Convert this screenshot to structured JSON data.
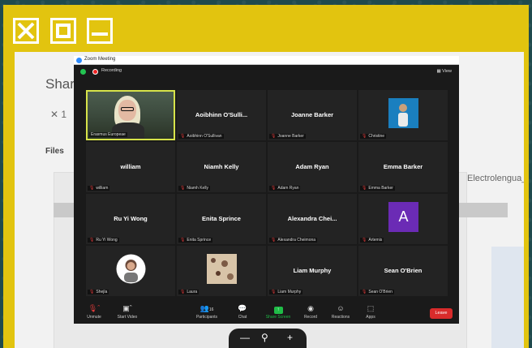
{
  "window_controls": {
    "close_icon": "close-icon",
    "maximize_icon": "maximize-icon",
    "minimize_icon": "minimize-icon"
  },
  "background": {
    "title": "Shar",
    "close": "✕  1",
    "files": "Files",
    "right_text": "Electrolengua_"
  },
  "zoom": {
    "window_title": "Zoom Meeting",
    "recording_label": "Recording",
    "view_label": "View",
    "participants": [
      {
        "name": "",
        "label": "Erasmus Europeae",
        "type": "video",
        "active": true
      },
      {
        "name": "Aoibhinn  O'Sulli...",
        "label": "Aoibhinn O'Sullivan",
        "type": "name"
      },
      {
        "name": "Joanne Barker",
        "label": "Joanne Barker",
        "type": "name"
      },
      {
        "name": "",
        "label": "Christine",
        "type": "photo-blue"
      },
      {
        "name": "william",
        "label": "william",
        "type": "name"
      },
      {
        "name": "Niamh Kelly",
        "label": "Niamh Kelly",
        "type": "name"
      },
      {
        "name": "Adam Ryan",
        "label": "Adam Ryan",
        "type": "name"
      },
      {
        "name": "Emma Barker",
        "label": "Emma Barker",
        "type": "name"
      },
      {
        "name": "Ru Yi Wong",
        "label": "Ru Yi Wong",
        "type": "name"
      },
      {
        "name": "Enita Sprince",
        "label": "Enita Sprince",
        "type": "name"
      },
      {
        "name": "Alexandra  Chei...",
        "label": "Alexandra Cheimona",
        "type": "name"
      },
      {
        "name": "A",
        "label": "Artemis",
        "type": "letter"
      },
      {
        "name": "",
        "label": "Shejla",
        "type": "photo-person"
      },
      {
        "name": "",
        "label": "Laura",
        "type": "photo-texture"
      },
      {
        "name": "Liam Murphy",
        "label": "Liam Murphy",
        "type": "name"
      },
      {
        "name": "Sean O'Brien",
        "label": "Sean O'Brien",
        "type": "name"
      }
    ],
    "toolbar": {
      "unmute": "Unmute",
      "start_video": "Start Video",
      "participants": "Participants",
      "participants_count": "16",
      "chat": "Chat",
      "share_screen": "Share Screen",
      "record": "Record",
      "reactions": "Reactions",
      "apps": "Apps",
      "leave": "Leave"
    }
  },
  "pill": {
    "minus": "—",
    "zoom_icon": "⚲",
    "plus": "+"
  }
}
